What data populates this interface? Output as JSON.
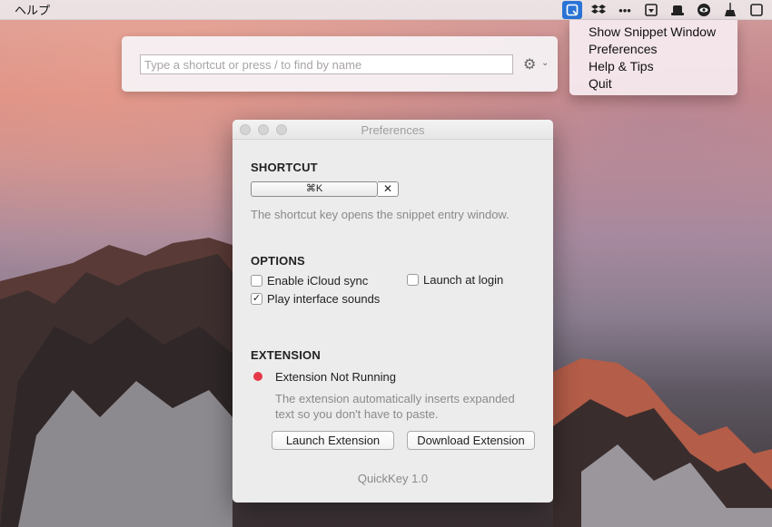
{
  "menubar": {
    "help": "ヘルプ",
    "icons": [
      "quickkey-icon",
      "dropbox-icon",
      "more-icon",
      "download-icon",
      "hat-icon",
      "eye-icon",
      "broom-icon",
      "window-icon"
    ]
  },
  "status_menu": {
    "items": [
      "Show Snippet Window",
      "Preferences",
      "Help & Tips",
      "Quit"
    ]
  },
  "snippet": {
    "placeholder": "Type a shortcut or press / to find by name"
  },
  "prefs": {
    "title": "Preferences",
    "shortcut_heading": "SHORTCUT",
    "shortcut_value": "⌘K",
    "shortcut_clear": "✕",
    "shortcut_hint": "The shortcut key opens the snippet entry window.",
    "options_heading": "OPTIONS",
    "opt_icloud": "Enable iCloud sync",
    "opt_login": "Launch at login",
    "opt_sounds": "Play interface sounds",
    "opt_sounds_checked": "✓",
    "extension_heading": "EXTENSION",
    "extension_status": "Extension Not Running",
    "extension_hint_1": "The extension automatically inserts expanded",
    "extension_hint_2": "text so you don't have to paste.",
    "launch_btn": "Launch Extension",
    "download_btn": "Download Extension",
    "version": "QuickKey 1.0"
  },
  "colors": {
    "status_dot": "#e5394a",
    "accent": "#2a74d6"
  }
}
